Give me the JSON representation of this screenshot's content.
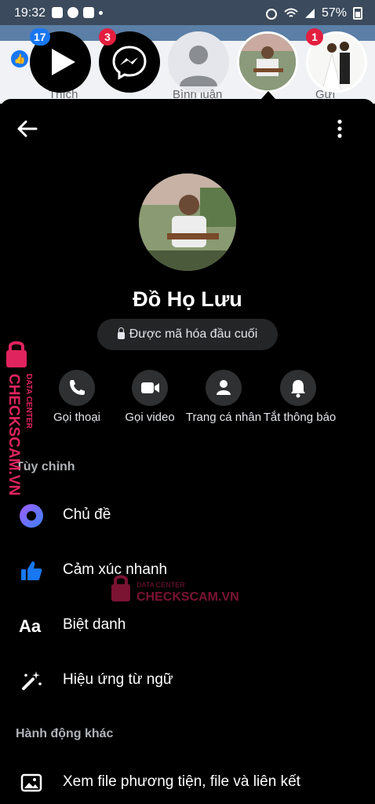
{
  "status_bar": {
    "time": "19:32",
    "battery": "57%"
  },
  "background_feed": {
    "like_label": "Thích",
    "comment_label": "Bình luận",
    "send_label": "Gửi"
  },
  "chat_heads": {
    "badge_play": "17",
    "badge_messenger": "3",
    "badge_photo2": "1"
  },
  "profile": {
    "name": "Đồ Họ Lưu",
    "encryption_label": "Được mã hóa đầu cuối"
  },
  "actions": [
    {
      "label": "Gọi thoại",
      "icon": "phone-icon"
    },
    {
      "label": "Gọi video",
      "icon": "video-icon"
    },
    {
      "label": "Trang cá nhân",
      "icon": "person-icon"
    },
    {
      "label": "Tắt thông báo",
      "icon": "bell-icon"
    }
  ],
  "customize": {
    "title": "Tùy chỉnh",
    "items": [
      {
        "label": "Chủ đề",
        "icon": "theme-icon"
      },
      {
        "label": "Cảm xúc nhanh",
        "icon": "thumbs-up-icon"
      },
      {
        "label": "Biệt danh",
        "icon": "nickname-icon"
      },
      {
        "label": "Hiệu ứng từ ngữ",
        "icon": "magic-wand-icon"
      }
    ]
  },
  "other_actions": {
    "title": "Hành động khác",
    "items": [
      {
        "label": "Xem file phương tiện, file và liên kết",
        "icon": "image-icon"
      }
    ]
  },
  "watermark": {
    "brand": "CHECKSCAM.VN",
    "sub": "DATA CENTER",
    "brand_center": "CHECKSCAM.VN"
  },
  "colors": {
    "accent": "#1877f2",
    "badge_red": "#e41e3f",
    "theme_purple": "#7b61ff",
    "watermark_red": "#e0245e"
  }
}
